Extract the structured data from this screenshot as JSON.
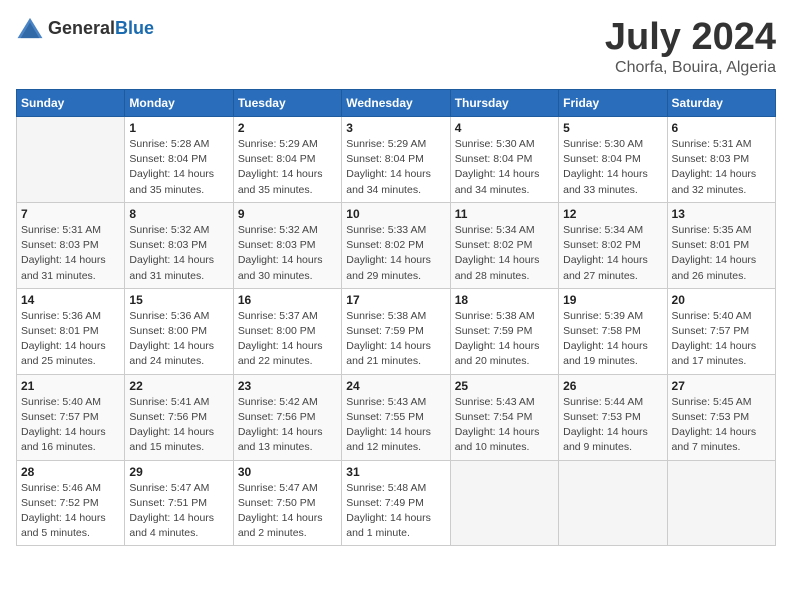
{
  "header": {
    "logo_general": "General",
    "logo_blue": "Blue",
    "title": "July 2024",
    "subtitle": "Chorfa, Bouira, Algeria"
  },
  "calendar": {
    "columns": [
      "Sunday",
      "Monday",
      "Tuesday",
      "Wednesday",
      "Thursday",
      "Friday",
      "Saturday"
    ],
    "weeks": [
      [
        {
          "day": "",
          "info": ""
        },
        {
          "day": "1",
          "info": "Sunrise: 5:28 AM\nSunset: 8:04 PM\nDaylight: 14 hours\nand 35 minutes."
        },
        {
          "day": "2",
          "info": "Sunrise: 5:29 AM\nSunset: 8:04 PM\nDaylight: 14 hours\nand 35 minutes."
        },
        {
          "day": "3",
          "info": "Sunrise: 5:29 AM\nSunset: 8:04 PM\nDaylight: 14 hours\nand 34 minutes."
        },
        {
          "day": "4",
          "info": "Sunrise: 5:30 AM\nSunset: 8:04 PM\nDaylight: 14 hours\nand 34 minutes."
        },
        {
          "day": "5",
          "info": "Sunrise: 5:30 AM\nSunset: 8:04 PM\nDaylight: 14 hours\nand 33 minutes."
        },
        {
          "day": "6",
          "info": "Sunrise: 5:31 AM\nSunset: 8:03 PM\nDaylight: 14 hours\nand 32 minutes."
        }
      ],
      [
        {
          "day": "7",
          "info": "Sunrise: 5:31 AM\nSunset: 8:03 PM\nDaylight: 14 hours\nand 31 minutes."
        },
        {
          "day": "8",
          "info": "Sunrise: 5:32 AM\nSunset: 8:03 PM\nDaylight: 14 hours\nand 31 minutes."
        },
        {
          "day": "9",
          "info": "Sunrise: 5:32 AM\nSunset: 8:03 PM\nDaylight: 14 hours\nand 30 minutes."
        },
        {
          "day": "10",
          "info": "Sunrise: 5:33 AM\nSunset: 8:02 PM\nDaylight: 14 hours\nand 29 minutes."
        },
        {
          "day": "11",
          "info": "Sunrise: 5:34 AM\nSunset: 8:02 PM\nDaylight: 14 hours\nand 28 minutes."
        },
        {
          "day": "12",
          "info": "Sunrise: 5:34 AM\nSunset: 8:02 PM\nDaylight: 14 hours\nand 27 minutes."
        },
        {
          "day": "13",
          "info": "Sunrise: 5:35 AM\nSunset: 8:01 PM\nDaylight: 14 hours\nand 26 minutes."
        }
      ],
      [
        {
          "day": "14",
          "info": "Sunrise: 5:36 AM\nSunset: 8:01 PM\nDaylight: 14 hours\nand 25 minutes."
        },
        {
          "day": "15",
          "info": "Sunrise: 5:36 AM\nSunset: 8:00 PM\nDaylight: 14 hours\nand 24 minutes."
        },
        {
          "day": "16",
          "info": "Sunrise: 5:37 AM\nSunset: 8:00 PM\nDaylight: 14 hours\nand 22 minutes."
        },
        {
          "day": "17",
          "info": "Sunrise: 5:38 AM\nSunset: 7:59 PM\nDaylight: 14 hours\nand 21 minutes."
        },
        {
          "day": "18",
          "info": "Sunrise: 5:38 AM\nSunset: 7:59 PM\nDaylight: 14 hours\nand 20 minutes."
        },
        {
          "day": "19",
          "info": "Sunrise: 5:39 AM\nSunset: 7:58 PM\nDaylight: 14 hours\nand 19 minutes."
        },
        {
          "day": "20",
          "info": "Sunrise: 5:40 AM\nSunset: 7:57 PM\nDaylight: 14 hours\nand 17 minutes."
        }
      ],
      [
        {
          "day": "21",
          "info": "Sunrise: 5:40 AM\nSunset: 7:57 PM\nDaylight: 14 hours\nand 16 minutes."
        },
        {
          "day": "22",
          "info": "Sunrise: 5:41 AM\nSunset: 7:56 PM\nDaylight: 14 hours\nand 15 minutes."
        },
        {
          "day": "23",
          "info": "Sunrise: 5:42 AM\nSunset: 7:56 PM\nDaylight: 14 hours\nand 13 minutes."
        },
        {
          "day": "24",
          "info": "Sunrise: 5:43 AM\nSunset: 7:55 PM\nDaylight: 14 hours\nand 12 minutes."
        },
        {
          "day": "25",
          "info": "Sunrise: 5:43 AM\nSunset: 7:54 PM\nDaylight: 14 hours\nand 10 minutes."
        },
        {
          "day": "26",
          "info": "Sunrise: 5:44 AM\nSunset: 7:53 PM\nDaylight: 14 hours\nand 9 minutes."
        },
        {
          "day": "27",
          "info": "Sunrise: 5:45 AM\nSunset: 7:53 PM\nDaylight: 14 hours\nand 7 minutes."
        }
      ],
      [
        {
          "day": "28",
          "info": "Sunrise: 5:46 AM\nSunset: 7:52 PM\nDaylight: 14 hours\nand 5 minutes."
        },
        {
          "day": "29",
          "info": "Sunrise: 5:47 AM\nSunset: 7:51 PM\nDaylight: 14 hours\nand 4 minutes."
        },
        {
          "day": "30",
          "info": "Sunrise: 5:47 AM\nSunset: 7:50 PM\nDaylight: 14 hours\nand 2 minutes."
        },
        {
          "day": "31",
          "info": "Sunrise: 5:48 AM\nSunset: 7:49 PM\nDaylight: 14 hours\nand 1 minute."
        },
        {
          "day": "",
          "info": ""
        },
        {
          "day": "",
          "info": ""
        },
        {
          "day": "",
          "info": ""
        }
      ]
    ]
  }
}
